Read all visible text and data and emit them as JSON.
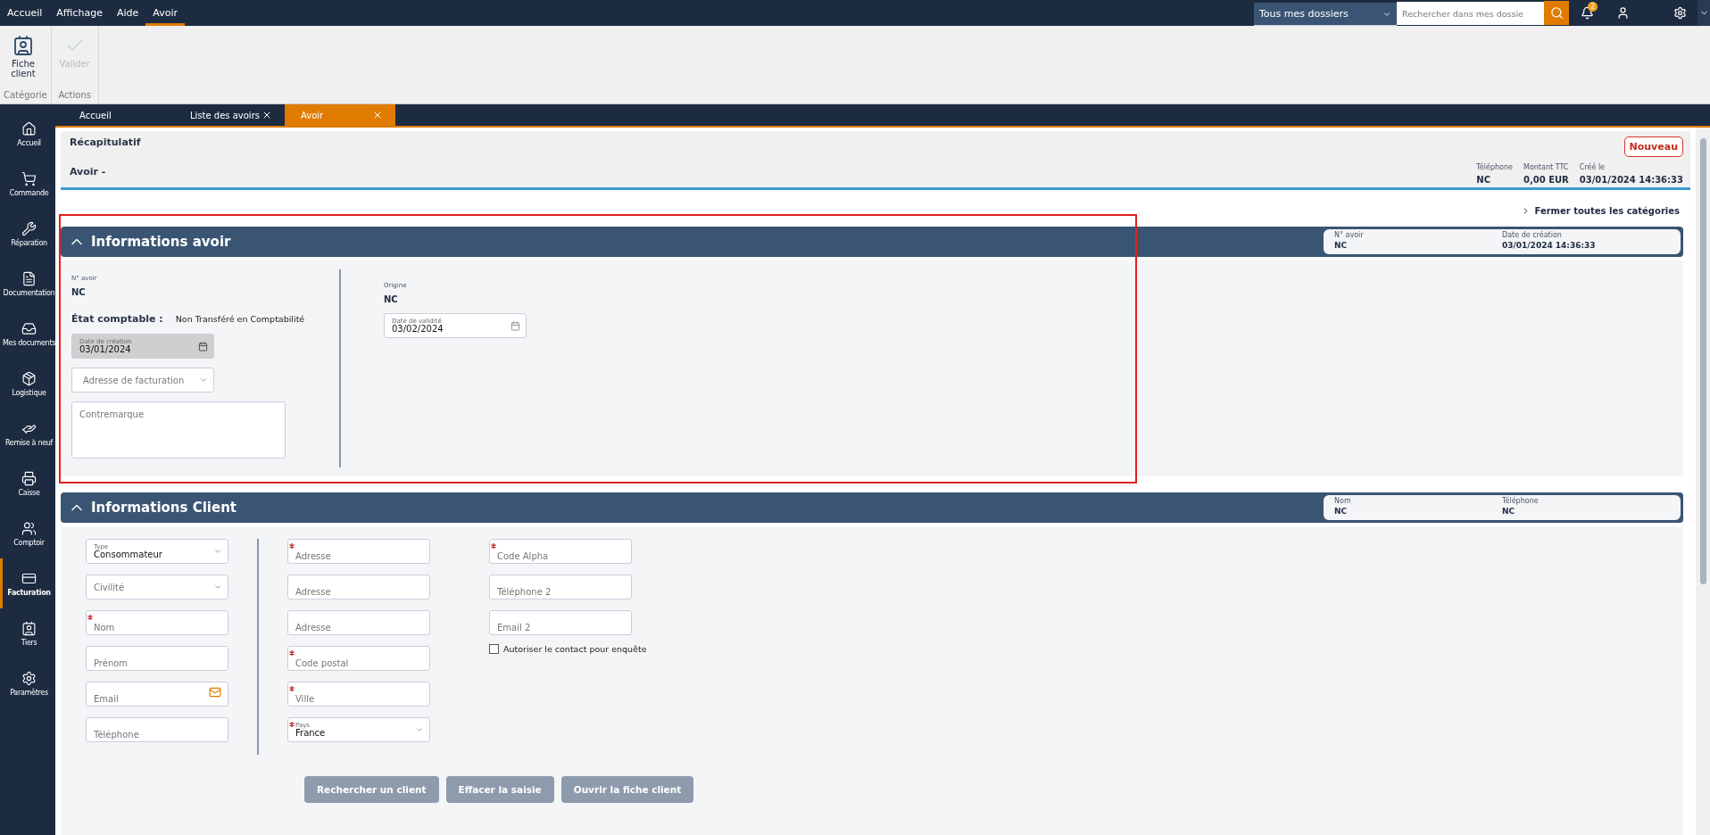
{
  "menu_bar": {
    "items": [
      {
        "label": "Accueil",
        "selected": false
      },
      {
        "label": "Affichage",
        "selected": false
      },
      {
        "label": "Aide",
        "selected": false
      },
      {
        "label": "Avoir",
        "selected": true
      }
    ],
    "folder_select": "Tous mes dossiers",
    "search": {
      "placeholder": "Rechercher dans mes dossie"
    },
    "notification_count": "2"
  },
  "ribbon": {
    "groups": [
      {
        "label": "Catégorie",
        "buttons": [
          {
            "label": "Fiche client",
            "disabled": false
          }
        ]
      },
      {
        "label": "Actions",
        "buttons": [
          {
            "label": "Valider",
            "disabled": true
          }
        ]
      }
    ]
  },
  "doc_tabs": [
    {
      "label": "Accueil",
      "selected": false,
      "closable": false
    },
    {
      "label": "Liste des avoirs",
      "selected": false,
      "closable": true
    },
    {
      "label": "Avoir",
      "selected": true,
      "closable": true
    }
  ],
  "sidebar": {
    "items": [
      {
        "label": "Accueil",
        "selected": false
      },
      {
        "label": "Commande",
        "selected": false
      },
      {
        "label": "Réparation",
        "selected": false
      },
      {
        "label": "Documentation",
        "selected": false
      },
      {
        "label": "Mes documents",
        "selected": false
      },
      {
        "label": "Logistique",
        "selected": false
      },
      {
        "label": "Remise à neuf",
        "selected": false
      },
      {
        "label": "Caisse",
        "selected": false
      },
      {
        "label": "Comptoir",
        "selected": false
      },
      {
        "label": "Facturation",
        "selected": true
      },
      {
        "label": "Tiers",
        "selected": false
      },
      {
        "label": "Paramètres",
        "selected": false
      }
    ]
  },
  "summary": {
    "title": "Récapitulatif",
    "subtitle": "Avoir -",
    "button": "Nouveau",
    "fields": [
      {
        "label": "Téléphone",
        "value": "NC"
      },
      {
        "label": "Montant TTC",
        "value": "0,00 EUR"
      },
      {
        "label": "Créé le",
        "value": "03/01/2024 14:36:33"
      }
    ]
  },
  "collapse_all_link": "Fermer toutes les catégories",
  "avoir_section": {
    "title": "Informations avoir",
    "expanded": true,
    "summary": [
      {
        "label": "N° avoir",
        "value": "NC"
      },
      {
        "label": "Date de création",
        "value": "03/01/2024 14:36:33"
      }
    ],
    "number": {
      "label": "N° avoir",
      "value": "NC"
    },
    "accounting": {
      "label": "État comptable :",
      "value": "Non Transféré en Comptabilité"
    },
    "creation_date": {
      "label": "Date de création",
      "value": "03/01/2024",
      "disabled": true
    },
    "billing_address": {
      "placeholder": "Adresse de facturation"
    },
    "note": {
      "placeholder": "Contremarque"
    },
    "origin": {
      "label": "Origine",
      "value": "NC"
    },
    "validity_date": {
      "label": "Date de validité",
      "value": "03/02/2024",
      "disabled": false
    }
  },
  "client_section": {
    "title": "Informations Client",
    "expanded": true,
    "summary": [
      {
        "label": "Nom",
        "value": "NC"
      },
      {
        "label": "Téléphone",
        "value": "NC"
      }
    ],
    "columns": [
      [
        {
          "kind": "select",
          "label": "Type",
          "value": "Consommateur",
          "required": false
        },
        {
          "kind": "select",
          "placeholder": "Civilité",
          "required": false
        },
        {
          "kind": "text",
          "placeholder": "Nom",
          "required": true
        },
        {
          "kind": "text",
          "placeholder": "Prénom",
          "required": false
        },
        {
          "kind": "email",
          "placeholder": "Email",
          "required": false
        },
        {
          "kind": "text",
          "placeholder": "Téléphone",
          "required": false
        }
      ],
      [
        {
          "kind": "text",
          "placeholder": "Adresse",
          "required": true
        },
        {
          "kind": "text",
          "placeholder": "Adresse",
          "required": false
        },
        {
          "kind": "text",
          "placeholder": "Adresse",
          "required": false
        },
        {
          "kind": "text",
          "placeholder": "Code postal",
          "required": true
        },
        {
          "kind": "text",
          "placeholder": "Ville",
          "required": true
        },
        {
          "kind": "select",
          "label": "Pays",
          "value": "France",
          "required": true
        }
      ],
      [
        {
          "kind": "text",
          "placeholder": "Code Alpha",
          "required": true
        },
        {
          "kind": "text",
          "placeholder": "Téléphone 2",
          "required": false
        },
        {
          "kind": "text",
          "placeholder": "Email 2",
          "required": false
        }
      ]
    ],
    "consent": {
      "label": "Autoriser le contact pour enquête",
      "checked": false
    },
    "buttons": [
      {
        "label": "Rechercher un client",
        "disabled": true
      },
      {
        "label": "Effacer la saisie",
        "disabled": true
      },
      {
        "label": "Ouvrir la fiche client",
        "disabled": true
      }
    ]
  }
}
